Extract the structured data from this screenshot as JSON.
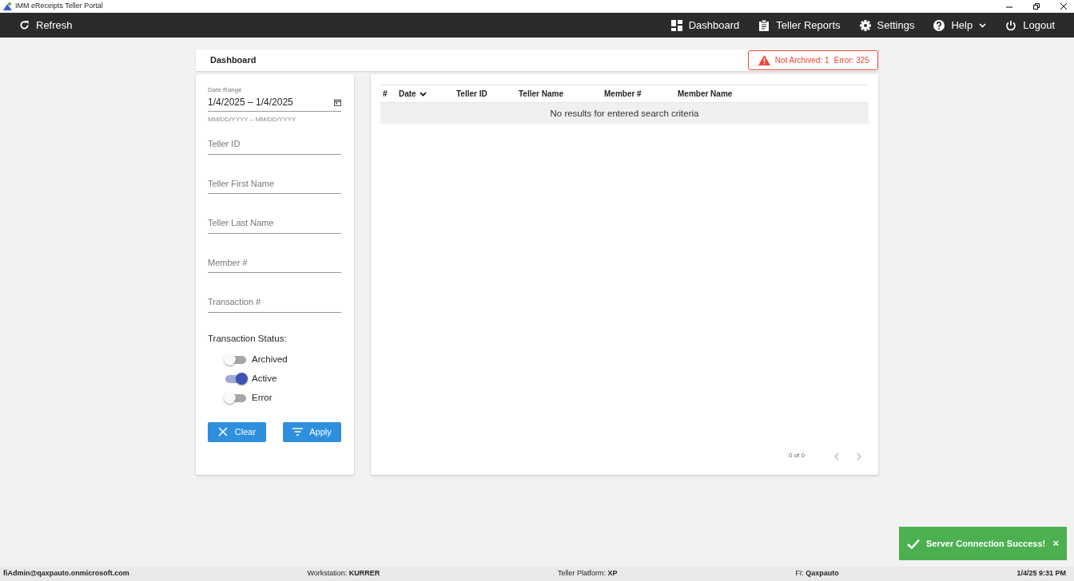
{
  "window": {
    "title": "IMM eReceipts Teller Portal"
  },
  "navbar": {
    "refresh": {
      "label": "Refresh"
    },
    "items": [
      {
        "kind": "dashboard",
        "label": "Dashboard",
        "dropdown": false
      },
      {
        "kind": "reports",
        "label": "Teller Reports",
        "dropdown": false
      },
      {
        "kind": "settings",
        "label": "Settings",
        "dropdown": false
      },
      {
        "kind": "help",
        "label": "Help",
        "dropdown": true
      },
      {
        "kind": "logout",
        "label": "Logout",
        "dropdown": false
      }
    ]
  },
  "header": {
    "title": "Dashboard",
    "alert": [
      "Not Archived: 1",
      "Error: 325"
    ]
  },
  "filters": {
    "date_range": {
      "label": "Date Range",
      "value": "1/4/2025 – 1/4/2025",
      "hint": "MM/DD/YYYY – MM/DD/YYYY"
    },
    "fields": [
      {
        "placeholder": "Teller ID"
      },
      {
        "placeholder": "Teller First Name"
      },
      {
        "placeholder": "Teller Last Name"
      },
      {
        "placeholder": "Member #"
      },
      {
        "placeholder": "Transaction #"
      }
    ],
    "status_label": "Transaction Status:",
    "toggles": [
      {
        "label": "Archived",
        "on": false
      },
      {
        "label": "Active",
        "on": true
      },
      {
        "label": "Error",
        "on": false
      }
    ],
    "buttons": [
      {
        "kind": "clear",
        "label": "Clear"
      },
      {
        "kind": "apply",
        "label": "Apply"
      }
    ]
  },
  "table": {
    "columns": [
      {
        "label": "#",
        "sorted": false
      },
      {
        "label": "Date",
        "sorted": true
      },
      {
        "label": "Teller ID",
        "sorted": false
      },
      {
        "label": "Teller Name",
        "sorted": false
      },
      {
        "label": "Member #",
        "sorted": false
      },
      {
        "label": "Member Name",
        "sorted": false
      }
    ],
    "empty_message": "No results for entered search criteria",
    "pagination": {
      "range": "0 of 0",
      "prev_disabled": true,
      "next_disabled": true
    }
  },
  "toast": {
    "message": "Server Connection Success!",
    "close": "×"
  },
  "status_bar": [
    {
      "value": "fiAdmin@qaxpauto.onmicrosoft.com"
    },
    {
      "label": "Workstation:",
      "value": "KURRER"
    },
    {
      "label": "Teller Platform:",
      "value": "XP"
    },
    {
      "label": "FI:",
      "value": "Qaxpauto"
    },
    {
      "value": "1/4/25 9:31 PM"
    }
  ]
}
